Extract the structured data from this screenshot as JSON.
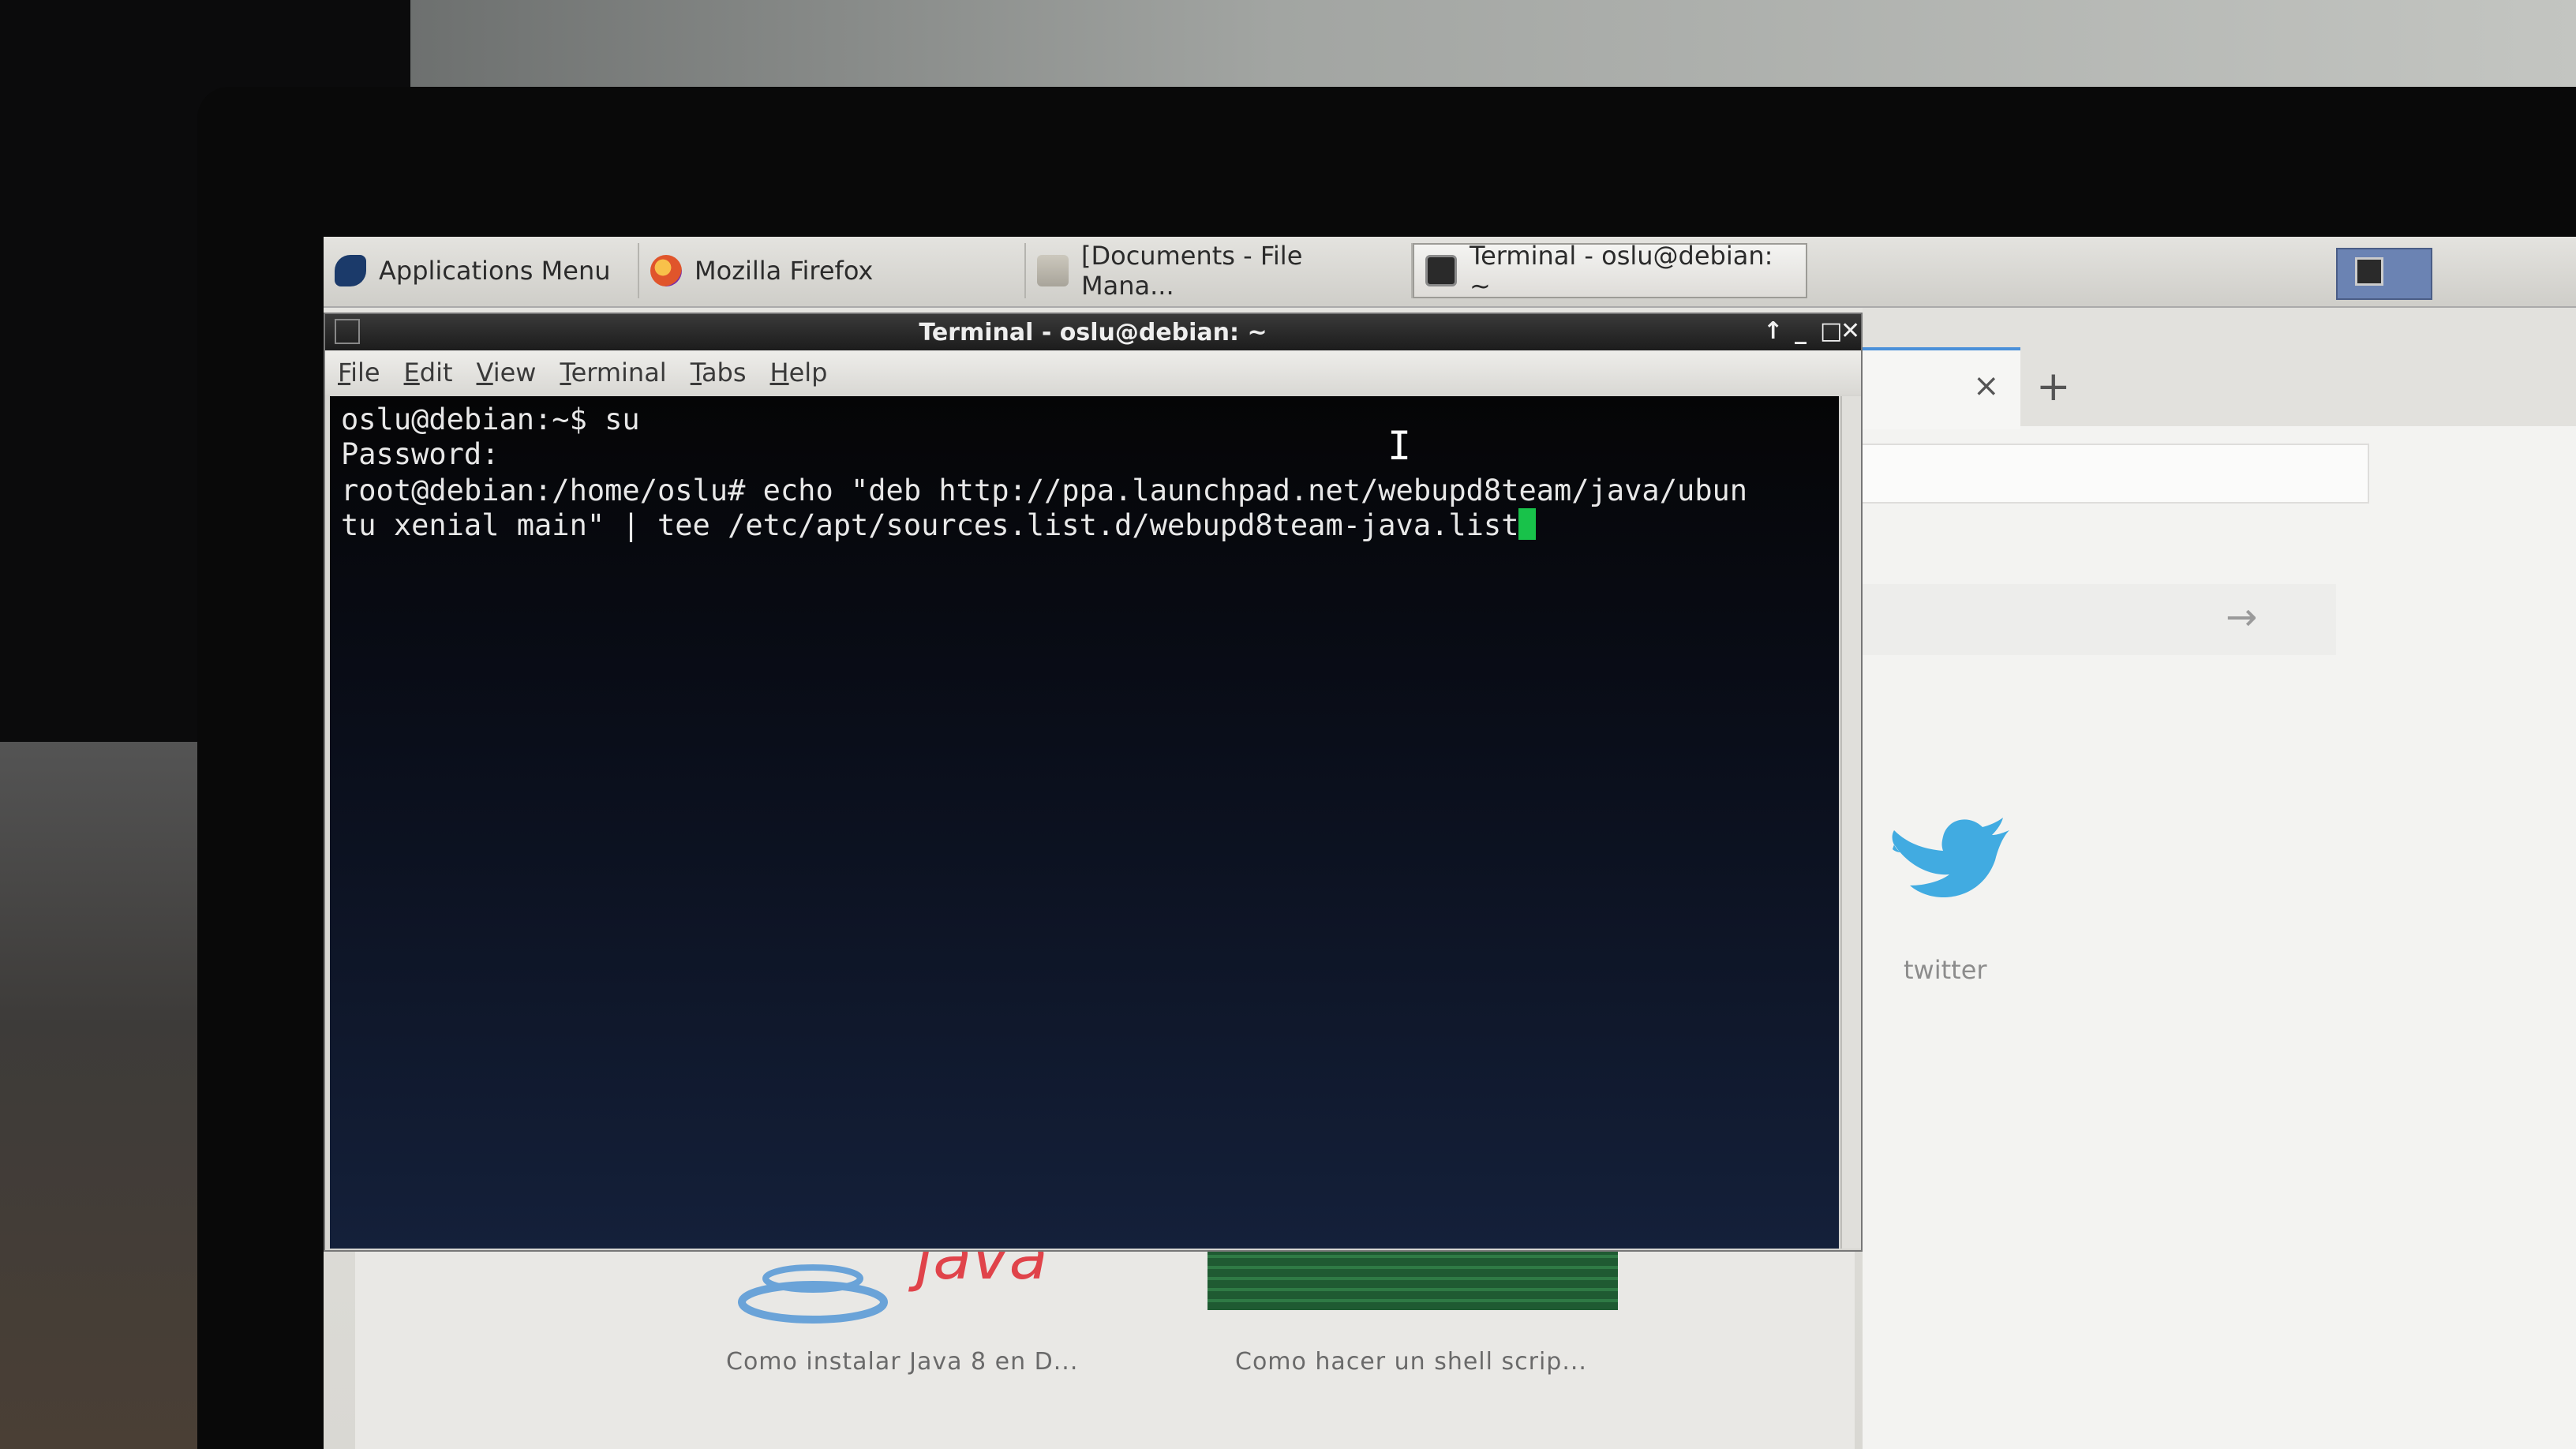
{
  "taskbar": {
    "items": [
      {
        "label": "Applications Menu",
        "icon": "app-menu-icon"
      },
      {
        "label": "Mozilla Firefox",
        "icon": "firefox-icon"
      },
      {
        "label": "[Documents - File Mana...",
        "icon": "folder-icon"
      },
      {
        "label": "Terminal - oslu@debian: ~",
        "icon": "terminal-icon"
      }
    ]
  },
  "terminal": {
    "title": "Terminal - oslu@debian: ~",
    "menu": [
      "File",
      "Edit",
      "View",
      "Terminal",
      "Tabs",
      "Help"
    ],
    "lines": [
      "oslu@debian:~$ su",
      "Password:",
      "root@debian:/home/oslu# echo \"deb http://ppa.launchpad.net/webupd8team/java/ubun",
      "tu xenial main\" | tee /etc/apt/sources.list.d/webupd8team-java.list"
    ]
  },
  "firefox": {
    "tab_close": "×",
    "new_tab": "+",
    "search_arrow": "→",
    "top_site": "twitter"
  },
  "tiles": [
    {
      "title": "Como instalar Java 8 en D...",
      "logo_text": "java"
    },
    {
      "title": "Como hacer un shell scrip..."
    }
  ],
  "colors": {
    "cursor": "#18c24a",
    "twitter": "#41abe1",
    "tab_accent": "#4a90d9"
  }
}
